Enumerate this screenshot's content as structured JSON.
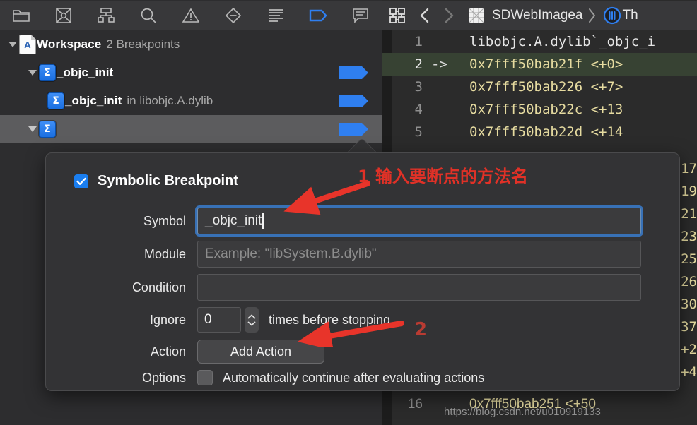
{
  "theme": {
    "accent_blue": "#1a7ef0",
    "bg_dark": "#2d2d2f",
    "code_bg": "#2b2b2b",
    "addr_yellow": "#e6dba0",
    "anno_red": "#e03127",
    "current_line_bg": "#374233"
  },
  "left_toolbar": {
    "icons": [
      {
        "name": "project-navigator-icon",
        "label": "folder"
      },
      {
        "name": "source-control-navigator-icon",
        "label": "source-control"
      },
      {
        "name": "symbol-navigator-icon",
        "label": "hierarchy"
      },
      {
        "name": "find-navigator-icon",
        "label": "search"
      },
      {
        "name": "issue-navigator-icon",
        "label": "warning"
      },
      {
        "name": "test-navigator-icon",
        "label": "diamond-minus"
      },
      {
        "name": "debug-navigator-icon",
        "label": "list"
      },
      {
        "name": "breakpoint-navigator-icon",
        "label": "breakpoint-flag"
      },
      {
        "name": "report-navigator-icon",
        "label": "message"
      }
    ]
  },
  "breakpoints": {
    "rows": [
      {
        "indent": 0,
        "disclosure": "open",
        "icon": "workspace-document-icon",
        "label": "Workspace",
        "sub": "2 Breakpoints",
        "flag": false,
        "selected": false
      },
      {
        "indent": 1,
        "disclosure": "open",
        "icon": "symbolic-breakpoint-icon",
        "label": "_objc_init",
        "sub": "",
        "flag": true,
        "selected": false
      },
      {
        "indent": 2,
        "disclosure": "none",
        "icon": "symbolic-breakpoint-icon",
        "label": "_objc_init",
        "sub": "in libobjc.A.dylib",
        "flag": true,
        "selected": false
      },
      {
        "indent": 1,
        "disclosure": "open",
        "icon": "symbolic-breakpoint-icon",
        "label": "",
        "sub": "",
        "flag": true,
        "selected": true
      }
    ]
  },
  "code_topbar": {
    "grid_icon": "related-items-icon",
    "back_label": "‹",
    "forward_label": "›",
    "file_icon": "assembly-file-icon",
    "breadcrumb": [
      "SDWebImagea",
      "Th"
    ],
    "chevron": "›",
    "thread_badge": "thread-icon"
  },
  "code": {
    "lines": [
      {
        "num": "1",
        "arrow": "",
        "text": "libobjc.A.dylib`_objc_i",
        "kind": "plain",
        "current": false
      },
      {
        "num": "2",
        "arrow": "->",
        "text": "0x7fff50bab21f <+0>",
        "kind": "addr",
        "current": true
      },
      {
        "num": "3",
        "arrow": "",
        "text": "0x7fff50bab226 <+7>",
        "kind": "addr",
        "current": false
      },
      {
        "num": "4",
        "arrow": "",
        "text": "0x7fff50bab22c <+13",
        "kind": "addr",
        "current": false
      },
      {
        "num": "5",
        "arrow": "",
        "text": "0x7fff50bab22d <+14",
        "kind": "addr",
        "current": false
      }
    ],
    "bottom_lines": [
      {
        "num": "16",
        "arrow": "",
        "text": "0x7fff50bab251 <+50",
        "kind": "addr",
        "current": false
      }
    ],
    "tail_offsets": [
      "17",
      "19",
      "21",
      "23",
      "25",
      "26",
      "30",
      "37",
      "+2",
      "+4"
    ]
  },
  "popover": {
    "checkbox_checked": true,
    "title": "Symbolic Breakpoint",
    "fields": [
      {
        "label": "Symbol",
        "value": "_objc_init",
        "placeholder": "",
        "focused": true
      },
      {
        "label": "Module",
        "value": "",
        "placeholder": "Example: \"libSystem.B.dylib\"",
        "focused": false
      },
      {
        "label": "Condition",
        "value": "",
        "placeholder": "",
        "focused": false
      }
    ],
    "ignore": {
      "label": "Ignore",
      "value": "0",
      "suffix": "times before stopping"
    },
    "action": {
      "label": "Action",
      "button": "Add Action"
    },
    "options": {
      "label": "Options",
      "checkbox_checked": false,
      "text": "Automatically continue after evaluating actions"
    }
  },
  "annotations": [
    {
      "id": "1",
      "text": "1 输入要断点的方法名"
    },
    {
      "id": "2",
      "text": "2"
    }
  ],
  "watermark": "https://blog.csdn.net/u010919133"
}
